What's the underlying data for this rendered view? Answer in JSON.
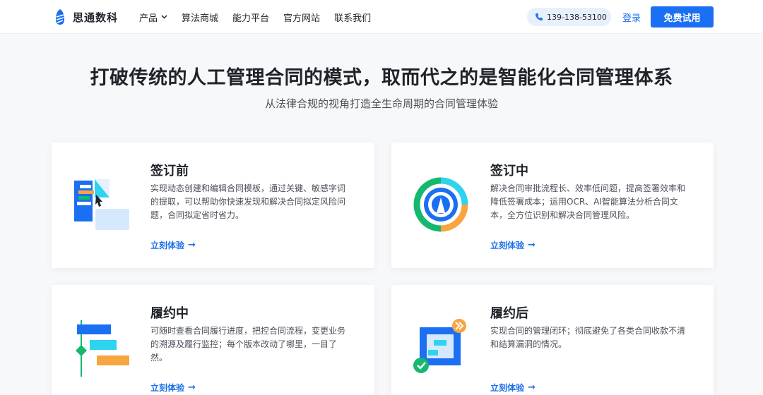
{
  "nav": {
    "brand": "思通数科",
    "menu": [
      "产品",
      "算法商城",
      "能力平台",
      "官方网站",
      "联系我们"
    ],
    "phone": "139-138-53100",
    "login": "登录",
    "cta": "免费试用"
  },
  "hero": {
    "title": "打破传统的人工管理合同的模式，取而代之的是智能化合同管理体系",
    "subtitle": "从法律合规的视角打造全生命周期的合同管理体验"
  },
  "cards": [
    {
      "title": "签订前",
      "desc": "实现动态创建和编辑合同模板，通过关键、敏感字词的提取，可以帮助你快速发现和解决合同拟定风险问题，合同拟定省时省力。",
      "cta": "立刻体验",
      "icon": "document-edit-illustration"
    },
    {
      "title": "签订中",
      "desc": "解决合同审批流程长、效率低问题，提高签署效率和降低签署成本；运用OCR、AI智能算法分析合同文本，全方位识别和解决合同管理风险。",
      "cta": "立刻体验",
      "icon": "circular-review-illustration"
    },
    {
      "title": "履约中",
      "desc": "可随时查看合同履行进度，把控合同流程，变更业务的溯源及履行监控；每个版本改动了哪里，一目了然。",
      "cta": "立刻体验",
      "icon": "gantt-progress-illustration"
    },
    {
      "title": "履约后",
      "desc": "实现合同的管理闭环；彻底避免了各类合同收款不清和结算漏洞的情况。",
      "cta": "立刻体验",
      "icon": "closed-loop-check-illustration"
    }
  ],
  "colors": {
    "primary": "#1a6ff2",
    "cyan": "#2ed3f0",
    "orange": "#f7a541",
    "green": "#14b86f",
    "light_blue": "#d6e8fb"
  }
}
